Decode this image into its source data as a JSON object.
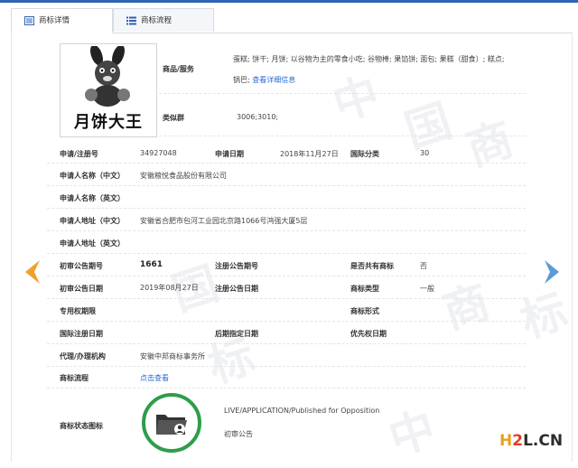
{
  "tabs": [
    {
      "label": "商标详情"
    },
    {
      "label": "商标流程"
    }
  ],
  "logo": {
    "text": "月饼大王"
  },
  "goods": {
    "label": "商品/服务",
    "line1": "蛋糕; 饼干; 月饼; 以谷物为主的零食小吃; 谷物棒; 果馅饼; 面包; 果糕（甜食）; 糕点;",
    "line2": "锅巴;",
    "more_link": "查看详细信息"
  },
  "similar": {
    "label": "类似群",
    "value": "3006;3010;"
  },
  "rows": {
    "reg_no_label": "申请/注册号",
    "reg_no": "34927048",
    "app_date_label": "申请日期",
    "app_date": "2018年11月27日",
    "intl_class_label": "国际分类",
    "intl_class": "30",
    "applicant_cn_label": "申请人名称（中文）",
    "applicant_cn": "安徽粮悦食品股份有限公司",
    "applicant_en_label": "申请人名称（英文）",
    "address_cn_label": "申请人地址（中文）",
    "address_cn": "安徽省合肥市包河工业园北京路1066号鸿强大厦5层",
    "address_en_label": "申请人地址（英文）",
    "prelim_no_label": "初审公告期号",
    "prelim_no": "1661",
    "reg_pub_no_label": "注册公告期号",
    "shared_label": "是否共有商标",
    "shared": "否",
    "prelim_date_label": "初审公告日期",
    "prelim_date": "2019年08月27日",
    "reg_pub_date_label": "注册公告日期",
    "mark_type_label": "商标类型",
    "mark_type": "一般",
    "exclusive_label": "专用权期限",
    "mark_form_label": "商标形式",
    "intl_reg_date_label": "国际注册日期",
    "later_date_label": "后期指定日期",
    "priority_label": "优先权日期",
    "agent_label": "代理/办理机构",
    "agent": "安徽中邦商标事务所",
    "flow_label": "商标流程",
    "flow_link": "点击查看",
    "status_label": "商标状态图标",
    "status_en": "LIVE/APPLICATION/Published for Opposition",
    "status_cn": "初审公告"
  },
  "watermark": {
    "chars": [
      "中",
      "国",
      "商",
      "标"
    ]
  },
  "footer_logo": {
    "part1": "H",
    "part2": "2",
    "part3": "L.CN"
  },
  "colors": {
    "accent": "#2f63b4",
    "link": "#2a6ad1",
    "arrow_left": "#f0a030",
    "arrow_right": "#5b9bd5",
    "status_green": "#2e9d4c"
  }
}
